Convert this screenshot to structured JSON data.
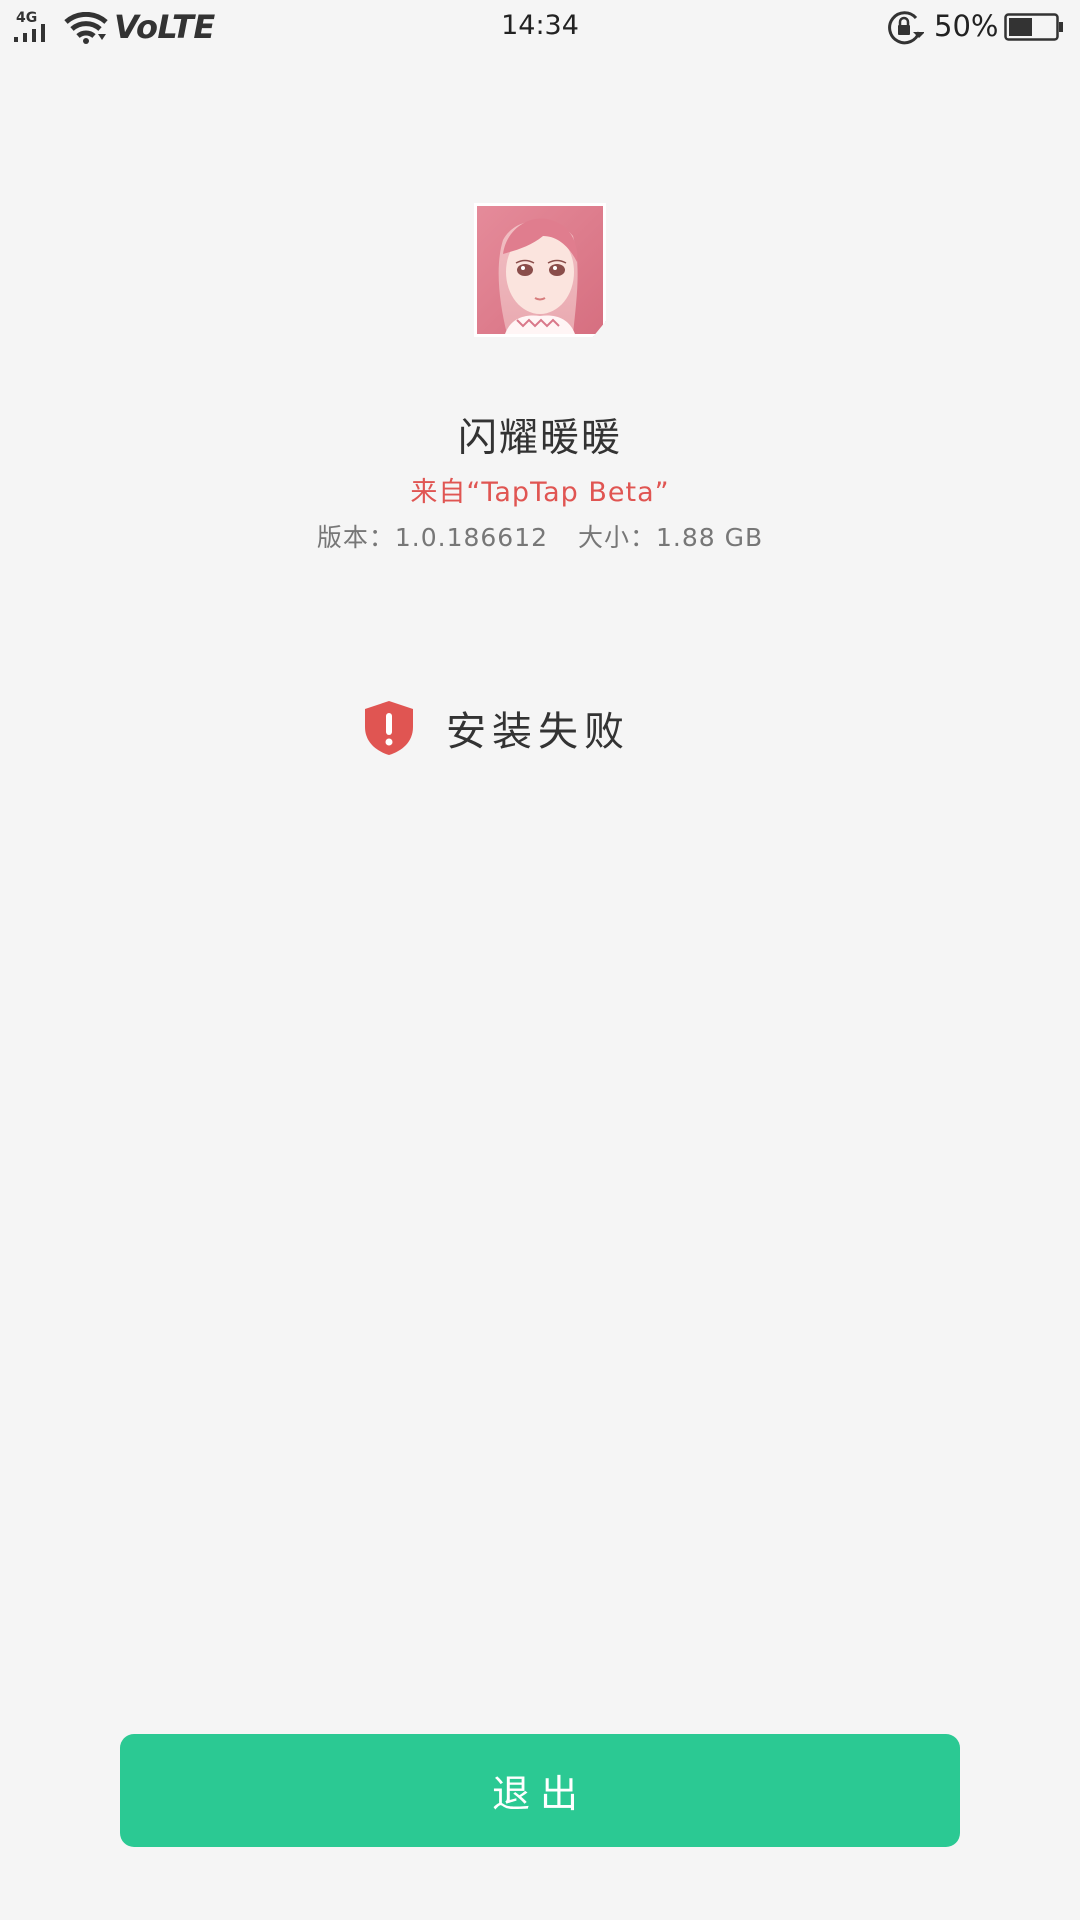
{
  "status_bar": {
    "network": "4G",
    "volte": "VoLTE",
    "time": "14:34",
    "battery_percent": "50%",
    "battery_level": 0.5,
    "icons": [
      "signal-icon",
      "wifi-icon",
      "rotation-lock-icon",
      "battery-icon"
    ]
  },
  "app": {
    "icon": "app-icon-anime-girl",
    "name": "闪耀暖暖",
    "source": "来自“TapTap Beta”",
    "version_label": "版本：",
    "version": "1.0.186612",
    "size_label": "大小：",
    "size": "1.88 GB"
  },
  "install": {
    "status_icon": "shield-alert-icon",
    "status_text": "安装失败"
  },
  "actions": {
    "exit_label": "退出"
  },
  "colors": {
    "background": "#f5f5f5",
    "accent_green": "#2bc993",
    "error_red": "#e05552",
    "text_dark": "#333333",
    "text_gray": "#777777"
  }
}
